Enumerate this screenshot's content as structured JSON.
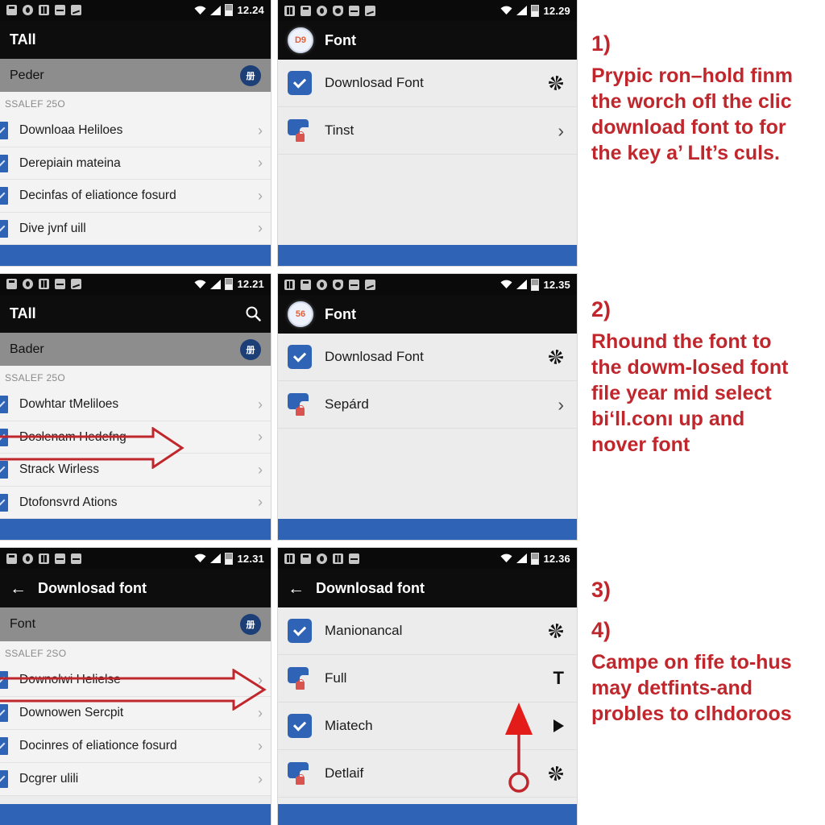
{
  "meta": {
    "accent_blue": "#2f63b5",
    "annotation_red": "#c0272d",
    "appbar_black": "#0d0d0d",
    "subheader_grey": "#8d8d8d",
    "list_grey": "#f3f3f3"
  },
  "panels": [
    {
      "id": "top-left",
      "status": {
        "time": "12.24",
        "icons": [
          "note-icon",
          "circle-icon",
          "card-icon",
          "dash-icon",
          "wave-icon"
        ],
        "wifi": "wifi-icon",
        "signal": "signal-icon",
        "battery": "battery-icon"
      },
      "appbar": {
        "title": "TAll",
        "action": ""
      },
      "subheader": {
        "title": "Peder",
        "avatar": "册"
      },
      "section_label": "SSALEF 25O",
      "rows": [
        {
          "label": "Downloaa Heliloes",
          "chevron": "›"
        },
        {
          "label": "Derepiain mateina",
          "chevron": "›"
        },
        {
          "label": "Decinfas of eliationce fosurd",
          "chevron": "›"
        },
        {
          "label": "Dive jvnf uill",
          "chevron": "›"
        }
      ]
    },
    {
      "id": "top-right",
      "status": {
        "time": "12.29",
        "icons": [
          "bars-icon",
          "note-icon",
          "circle-icon",
          "shield-icon",
          "dash-icon",
          "wave-icon"
        ],
        "wifi": "wifi-icon",
        "signal": "signal-icon",
        "battery": "battery-icon"
      },
      "appbar": {
        "badge": "D9",
        "title": "Font"
      },
      "rows": [
        {
          "label": "Downlosad Font",
          "icon": "chevron-box-icon",
          "trailing": "pinwheel-icon"
        },
        {
          "label": "Tinst",
          "icon": "locked-folder-icon",
          "trailing": "chevron-right-icon"
        }
      ]
    },
    {
      "id": "mid-left",
      "status": {
        "time": "12.21",
        "icons": [
          "note-icon",
          "circle-icon",
          "card-icon",
          "dash-icon",
          "wave-icon"
        ],
        "wifi": "wifi-icon",
        "signal": "signal-icon",
        "battery": "battery-icon"
      },
      "appbar": {
        "title": "TAll",
        "action": "search-icon"
      },
      "subheader": {
        "title": "Bader",
        "avatar": "册"
      },
      "section_label": "SSALEF 25O",
      "rows": [
        {
          "label": "Dowhtar tMeliloes",
          "chevron": "›"
        },
        {
          "label": "Doslenam Hedefng",
          "chevron": "›",
          "highlight": true
        },
        {
          "label": "Strack Wirless",
          "chevron": "›"
        },
        {
          "label": "Dtofonsvrd Ations",
          "chevron": "›"
        }
      ]
    },
    {
      "id": "mid-right",
      "status": {
        "time": "12.35",
        "icons": [
          "bars-icon",
          "note-icon",
          "circle-icon",
          "shield-icon",
          "dash-icon",
          "wave-icon"
        ],
        "wifi": "wifi-icon",
        "signal": "signal-icon",
        "battery": "battery-icon"
      },
      "appbar": {
        "badge": "56",
        "title": "Font"
      },
      "rows": [
        {
          "label": "Downlosad Font",
          "icon": "chevron-box-icon",
          "trailing": "pinwheel-icon"
        },
        {
          "label": "Sepárd",
          "icon": "locked-folder-icon",
          "trailing": "chevron-right-icon"
        }
      ]
    },
    {
      "id": "bottom-left",
      "status": {
        "time": "12.31",
        "icons": [
          "note-icon",
          "circle-icon",
          "card-icon",
          "dash-icon",
          "dash-icon"
        ],
        "wifi": "wifi-icon",
        "signal": "signal-icon",
        "battery": "battery-icon"
      },
      "appbar": {
        "back": "←",
        "title": "Downlosad font"
      },
      "subheader": {
        "title": "Font",
        "avatar": "册"
      },
      "section_label": "SSALEF 2SO",
      "rows": [
        {
          "label": "Downolwi Helielse",
          "chevron": "›",
          "highlight": true
        },
        {
          "label": "Downowen Sercpit",
          "chevron": "›"
        },
        {
          "label": "Docinres of eliationce fosurd",
          "chevron": "›"
        },
        {
          "label": "Dcgrer ulili",
          "chevron": "›"
        }
      ]
    },
    {
      "id": "bottom-right",
      "status": {
        "time": "12.36",
        "icons": [
          "bars-icon",
          "note-icon",
          "circle-icon",
          "card-icon",
          "dash-icon"
        ],
        "wifi": "wifi-icon",
        "signal": "signal-icon",
        "battery": "battery-icon"
      },
      "appbar": {
        "back": "←",
        "title": "Downlosad font"
      },
      "rows": [
        {
          "label": "Manionancal",
          "icon": "chevron-box-icon",
          "trailing": "pinwheel-icon"
        },
        {
          "label": "Full",
          "icon": "locked-folder-icon",
          "trailing": "text-T-icon"
        },
        {
          "label": "Miatech",
          "icon": "chevron-box-icon",
          "trailing": "play-icon"
        },
        {
          "label": "Detlaif",
          "icon": "locked-folder-icon",
          "trailing": "pinwheel-icon"
        }
      ]
    }
  ],
  "notes": [
    {
      "number": "1)",
      "lines": [
        "Prypic ron–hold finm",
        "the worch ofl the clic",
        "download font to for",
        "the key a’ LIt’s culs."
      ]
    },
    {
      "number": "2)",
      "lines": [
        "Rhound the font to",
        "the dowm-losed font",
        "file year mid select",
        "bi‘ll.conı up and",
        "nover font"
      ]
    },
    {
      "number": "3)",
      "lines": []
    },
    {
      "number": "4)",
      "lines": [
        "Campe on fife to-hus",
        "may detfints-and",
        "probles to clhdoroos"
      ]
    }
  ]
}
